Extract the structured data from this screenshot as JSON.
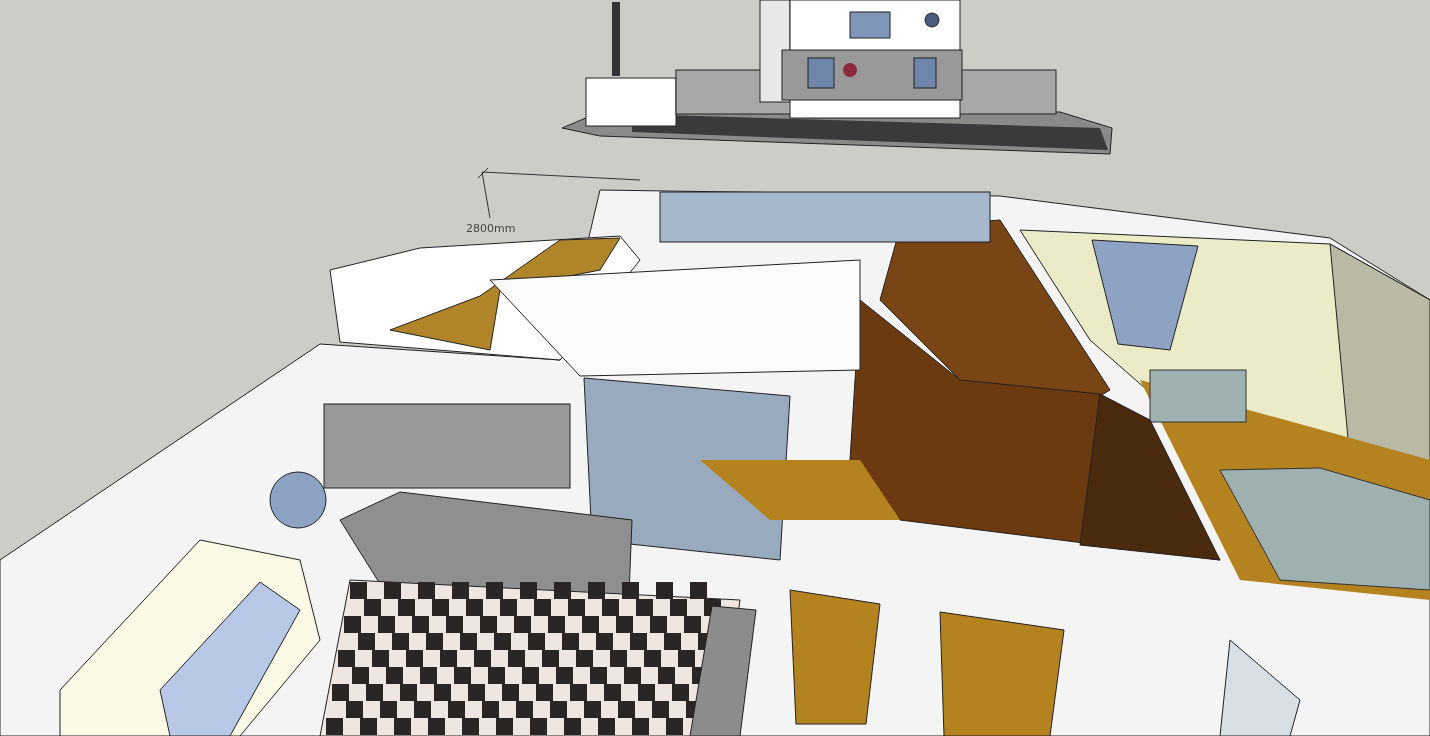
{
  "viewport": {
    "dimension_label": "2800mm"
  }
}
